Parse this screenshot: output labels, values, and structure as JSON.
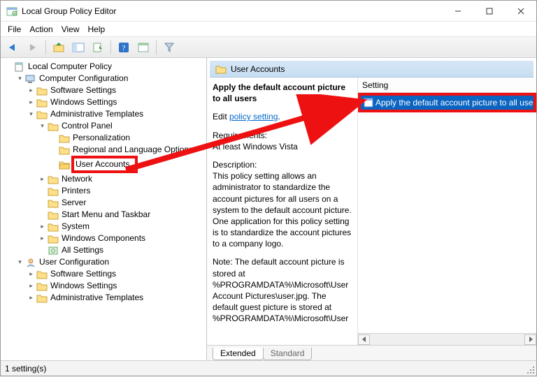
{
  "window": {
    "title": "Local Group Policy Editor"
  },
  "menubar": {
    "file": "File",
    "action": "Action",
    "view": "View",
    "help": "Help"
  },
  "tree": {
    "root": "Local Computer Policy",
    "cc": "Computer Configuration",
    "cc_sw": "Software Settings",
    "cc_ws": "Windows Settings",
    "cc_at": "Administrative Templates",
    "cp": "Control Panel",
    "cp_pers": "Personalization",
    "cp_rlo": "Regional and Language Options",
    "cp_ua": "User Accounts",
    "net": "Network",
    "prn": "Printers",
    "srv": "Server",
    "smtb": "Start Menu and Taskbar",
    "sys": "System",
    "wc": "Windows Components",
    "alls": "All Settings",
    "uc": "User Configuration",
    "uc_sw": "Software Settings",
    "uc_ws": "Windows Settings",
    "uc_at": "Administrative Templates"
  },
  "detail": {
    "header": "User Accounts",
    "policy_title": "Apply the default account picture to all users",
    "edit_prefix": "Edit ",
    "edit_link": "policy setting",
    "edit_suffix": ".",
    "req_label": "Requirements:",
    "req_value": "At least Windows Vista",
    "desc_label": "Description:",
    "desc_p1": "This policy setting allows an administrator to standardize the account pictures for all users on a system to the default account picture. One application for this policy setting is to standardize the account pictures to a company logo.",
    "desc_p2": "Note: The default account picture is stored at %PROGRAMDATA%\\Microsoft\\User Account Pictures\\user.jpg. The default guest picture is stored at %PROGRAMDATA%\\Microsoft\\User",
    "col_setting": "Setting",
    "row0": "Apply the default account picture to all users"
  },
  "tabs": {
    "extended": "Extended",
    "standard": "Standard"
  },
  "status": {
    "text": "1 setting(s)"
  }
}
